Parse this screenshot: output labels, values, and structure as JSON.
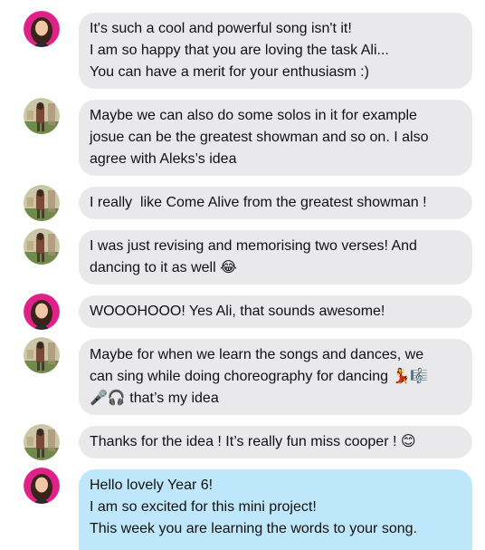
{
  "colors": {
    "bubble_grey": "#e9e9eb",
    "bubble_blue": "#bfe7fb",
    "text": "#111111"
  },
  "messages": [
    {
      "sender": "teacher",
      "avatar_icon": "teacher-avatar-icon",
      "lines": [
        "It's such a cool and powerful song isn't it!",
        "I am so happy that you are loving the task Ali...",
        "You can have a merit for your enthusiasm :)"
      ]
    },
    {
      "sender": "student",
      "avatar_icon": "student-avatar-icon",
      "lines": [
        "Maybe we can also do some solos in it for example",
        "josue can be the greatest showman and so on. I also",
        "agree with Aleks’s idea"
      ]
    },
    {
      "sender": "student",
      "avatar_icon": "student-avatar-icon",
      "lines": [
        "I really  like Come Alive from the greatest showman !"
      ]
    },
    {
      "sender": "student",
      "avatar_icon": "student-avatar-icon",
      "lines": [
        "I was just revising and memorising two verses! And",
        "dancing to it as well 😂"
      ]
    },
    {
      "sender": "teacher",
      "avatar_icon": "teacher-avatar-icon",
      "lines": [
        "WOOOHOOO! Yes Ali, that sounds awesome!"
      ]
    },
    {
      "sender": "student",
      "avatar_icon": "student-avatar-icon",
      "lines": [
        "Maybe for when we learn the songs and dances, we",
        "can sing while doing choreography for dancing 💃🎼",
        "🎤🎧 that’s my idea"
      ]
    },
    {
      "sender": "student",
      "avatar_icon": "student-avatar-icon",
      "lines": [
        "Thanks for the idea ! It’s really fun miss cooper ! 😊"
      ]
    },
    {
      "sender": "teacher",
      "avatar_icon": "teacher-avatar-icon",
      "lines": [
        "Hello lovely Year 6!",
        "I am so excited for this mini project!",
        "This week you are learning the words to your song."
      ]
    }
  ]
}
